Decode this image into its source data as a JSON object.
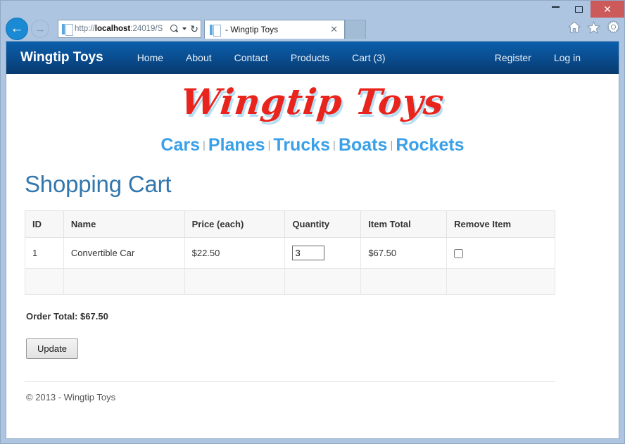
{
  "window": {
    "minimize_label": "–",
    "maximize_label": "□",
    "close_label": "✕"
  },
  "browser": {
    "back_label": "←",
    "forward_label": "→",
    "url_scheme": "http://",
    "url_host": "localhost",
    "url_rest": ":24019/S",
    "refresh_label": "↻",
    "tab_title": "- Wingtip Toys",
    "tab_close_label": "✕",
    "icons": [
      "home-icon",
      "favorites-star-icon",
      "settings-gear-icon"
    ]
  },
  "sitenav": {
    "brand": "Wingtip Toys",
    "left_links": [
      {
        "label": "Home"
      },
      {
        "label": "About"
      },
      {
        "label": "Contact"
      },
      {
        "label": "Products"
      },
      {
        "label": "Cart (3)"
      }
    ],
    "right_links": [
      {
        "label": "Register"
      },
      {
        "label": "Log in"
      }
    ],
    "gradient_top": "#0a5fab",
    "gradient_bottom": "#073a6e"
  },
  "logo": {
    "text": "Wingtip Toys",
    "color": "#e8241c",
    "shadow_color": "#b6dff5"
  },
  "categories": {
    "separator": "|",
    "color": "#3aa0e8",
    "items": [
      {
        "label": "Cars"
      },
      {
        "label": "Planes"
      },
      {
        "label": "Trucks"
      },
      {
        "label": "Boats"
      },
      {
        "label": "Rockets"
      }
    ]
  },
  "main": {
    "title": "Shopping Cart",
    "title_color": "#3277ad",
    "table": {
      "headers": [
        "ID",
        "Name",
        "Price (each)",
        "Quantity",
        "Item Total",
        "Remove Item"
      ],
      "rows": [
        {
          "id": "1",
          "name": "Convertible Car",
          "price": "$22.50",
          "quantity": "3",
          "item_total": "$67.50",
          "remove_checked": false
        }
      ]
    },
    "order_total": "Order Total: $67.50",
    "update_label": "Update"
  },
  "footer": {
    "text": "© 2013 - Wingtip Toys"
  }
}
